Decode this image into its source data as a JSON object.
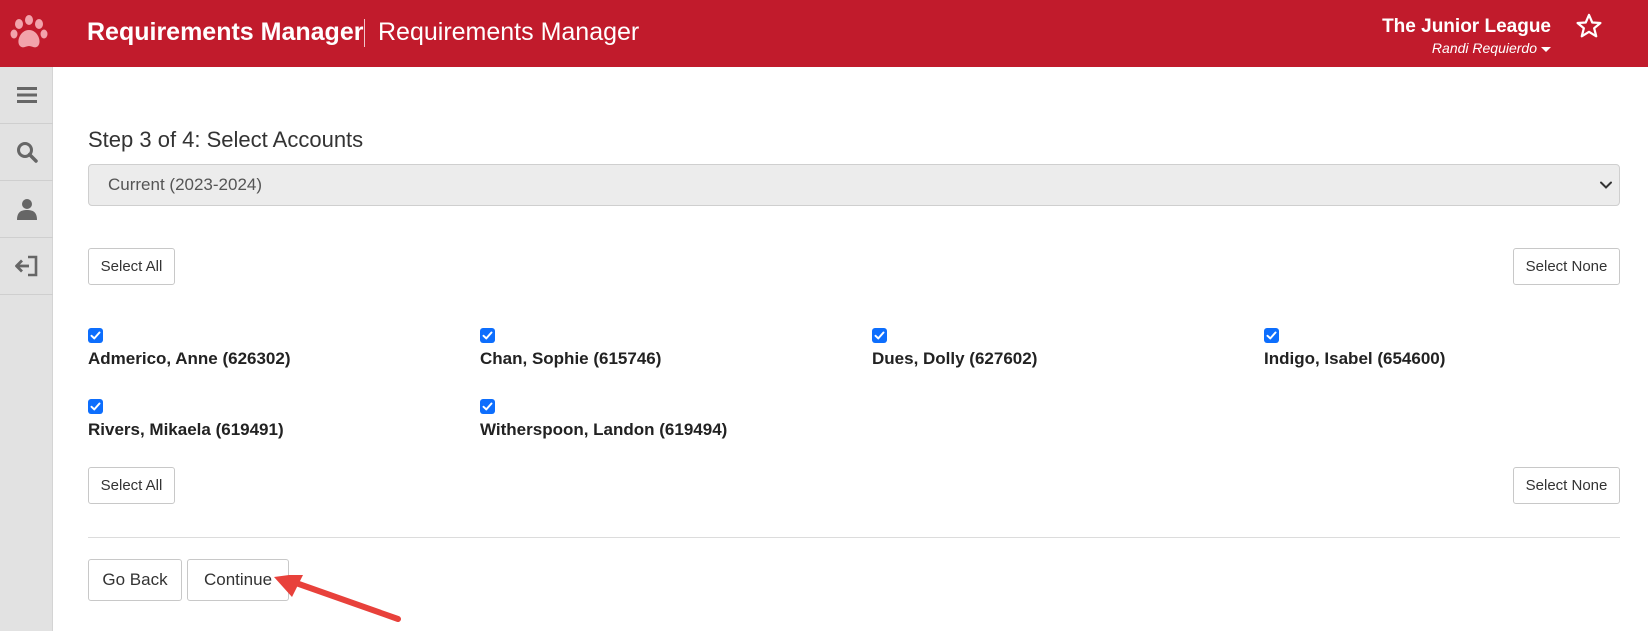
{
  "header": {
    "app_title": "Requirements Manager",
    "app_subtitle": "Requirements Manager",
    "org_name": "The Junior League",
    "user_name": "Randi Requierdo",
    "logo_icon": "paw-icon",
    "favorite_icon": "star-outline-icon"
  },
  "sidebar": {
    "items": [
      {
        "icon": "hamburger-menu-icon"
      },
      {
        "icon": "search-icon"
      },
      {
        "icon": "user-icon"
      },
      {
        "icon": "sign-out-icon"
      }
    ]
  },
  "main": {
    "step_title": "Step 3 of 4: Select Accounts",
    "season_select_value": "Current (2023-2024)",
    "select_all_label": "Select All",
    "select_none_label": "Select None",
    "accounts": [
      {
        "label": "Admerico, Anne (626302)",
        "checked": true
      },
      {
        "label": "Chan, Sophie (615746)",
        "checked": true
      },
      {
        "label": "Dues, Dolly (627602)",
        "checked": true
      },
      {
        "label": "Indigo, Isabel (654600)",
        "checked": true
      },
      {
        "label": "Rivers, Mikaela (619491)",
        "checked": true
      },
      {
        "label": "Witherspoon, Landon (619494)",
        "checked": true
      }
    ],
    "go_back_label": "Go Back",
    "continue_label": "Continue"
  },
  "colors": {
    "brand_red": "#c11b2c",
    "checkbox_blue": "#0d6efd",
    "annotation_arrow": "#e8413b"
  }
}
